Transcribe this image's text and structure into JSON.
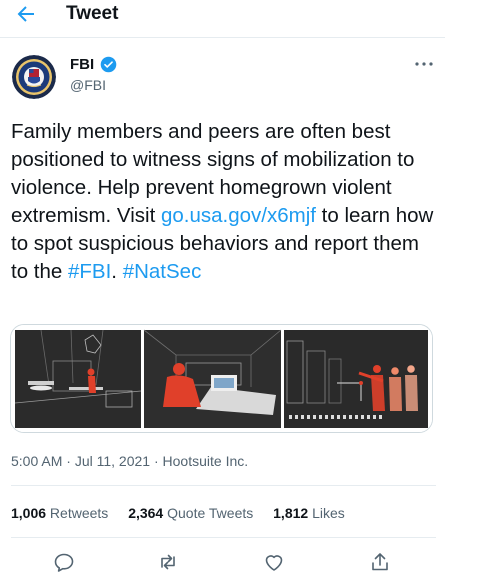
{
  "header": {
    "title": "Tweet",
    "back_icon": "arrow-left-icon"
  },
  "author": {
    "name": "FBI",
    "handle": "@FBI",
    "verified": true,
    "avatar_icon": "fbi-seal-icon"
  },
  "tweet": {
    "text_1": "Family members and peers are often best positioned to witness signs of mobilization to violence. Help prevent homegrown violent extremism. Visit ",
    "link": "go.usa.gov/x6mjf",
    "text_2": " to learn how to spot suspicious behaviors and report them to the ",
    "hashtag_1": "#FBI",
    "text_3": ". ",
    "hashtag_2": "#NatSec"
  },
  "meta": {
    "time": "5:00 AM",
    "sep1": " · ",
    "date": "Jul 11, 2021",
    "sep2": " · ",
    "source": "Hootsuite Inc."
  },
  "stats": [
    {
      "count": "1,006",
      "label": " Retweets"
    },
    {
      "count": "2,364",
      "label": " Quote Tweets"
    },
    {
      "count": "1,812",
      "label": " Likes"
    }
  ],
  "actions": [
    "reply-icon",
    "retweet-icon",
    "like-icon",
    "share-icon"
  ],
  "colors": {
    "link": "#1d9bf0",
    "verified": "#1d9bf0",
    "text": "#0f1419",
    "muted": "#536471",
    "accent_red": "#e0402a"
  }
}
